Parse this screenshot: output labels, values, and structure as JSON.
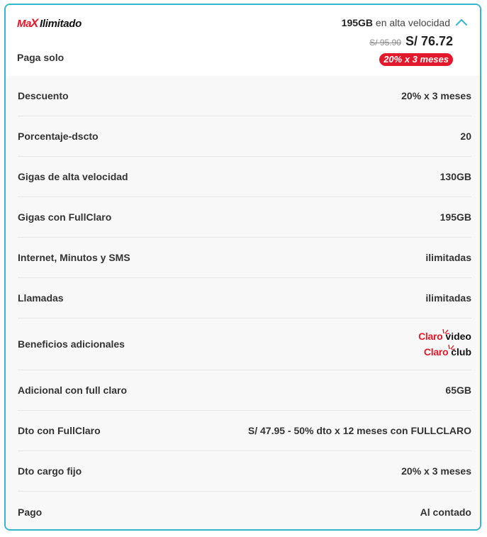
{
  "header": {
    "brand_max": "Ma",
    "brand_x": "X",
    "brand_name": "Ilimitado",
    "subtitle": "Paga solo",
    "speed_bold": "195GB",
    "speed_rest": " en alta velocidad",
    "old_price": "S/ 95.90",
    "new_price": "S/ 76.72",
    "promo_badge": "20% x 3 meses",
    "accent_color": "#e1192a",
    "border_color": "#36b6c9"
  },
  "rows": [
    {
      "label": "Descuento",
      "value": "20% x 3 meses"
    },
    {
      "label": "Porcentaje-dscto",
      "value": "20"
    },
    {
      "label": "Gigas de alta velocidad",
      "value": "130GB"
    },
    {
      "label": "Gigas con FullClaro",
      "value": "195GB"
    },
    {
      "label": "Internet, Minutos y SMS",
      "value": "ilimitadas"
    },
    {
      "label": "Llamadas",
      "value": "ilimitadas"
    },
    {
      "label": "Beneficios adicionales",
      "logos": [
        {
          "brand": "Claro",
          "product": "video"
        },
        {
          "brand": "Claro",
          "product": "club"
        }
      ]
    },
    {
      "label": "Adicional con full claro",
      "value": "65GB"
    },
    {
      "label": "Dto con FullClaro",
      "value": "S/ 47.95 - 50% dto x 12 meses con FULLCLARO"
    },
    {
      "label": "Dto cargo fijo",
      "value": "20% x 3 meses"
    },
    {
      "label": "Pago",
      "value": "Al contado"
    }
  ],
  "icons": {
    "collapse": "chevron-up-icon"
  }
}
